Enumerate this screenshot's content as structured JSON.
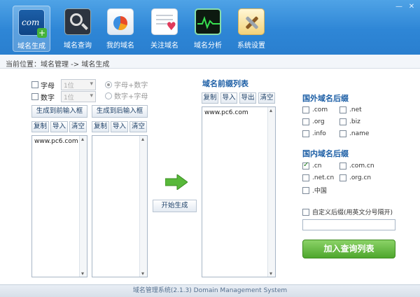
{
  "toolbar": {
    "items": [
      {
        "label": "域名生成",
        "icon": "com-plus-icon"
      },
      {
        "label": "域名查询",
        "icon": "magnifier-icon"
      },
      {
        "label": "我的域名",
        "icon": "pie-chart-icon"
      },
      {
        "label": "关注域名",
        "icon": "heart-list-icon"
      },
      {
        "label": "域名分析",
        "icon": "pulse-chart-icon"
      },
      {
        "label": "系统设置",
        "icon": "tools-icon"
      }
    ],
    "icon_text": "com",
    "icon_plus": "+"
  },
  "window": {
    "minimize": "—",
    "close": "✕"
  },
  "breadcrumb": "当前位置：域名管理 -> 域名生成",
  "generator": {
    "letters_label": "字母",
    "digits_label": "数字",
    "letters_len": "1位",
    "digits_len": "1位",
    "mode1": "字母+数字",
    "mode2": "数字+字母",
    "gen_to_prefix": "生成到前输入框",
    "gen_to_suffix": "生成到后输入框",
    "copy": "复制",
    "import": "导入",
    "clear": "清空",
    "prefix_input_text": "www.pc6.com",
    "start": "开始生成"
  },
  "prefix_list": {
    "title": "域名前缀列表",
    "copy": "复制",
    "import": "导入",
    "export": "导出",
    "clear": "清空",
    "text": "www.pc6.com"
  },
  "foreign": {
    "title": "国外域名后缀",
    "items": [
      {
        "label": ".com",
        "checked": false
      },
      {
        "label": ".net",
        "checked": false
      },
      {
        "label": ".org",
        "checked": false
      },
      {
        "label": ".biz",
        "checked": false
      },
      {
        "label": ".info",
        "checked": false
      },
      {
        "label": ".name",
        "checked": false
      }
    ]
  },
  "domestic": {
    "title": "国内域名后缀",
    "items": [
      {
        "label": ".cn",
        "checked": true
      },
      {
        "label": ".com.cn",
        "checked": false
      },
      {
        "label": ".net.cn",
        "checked": false
      },
      {
        "label": ".org.cn",
        "checked": false
      },
      {
        "label": ".中国",
        "checked": false
      }
    ]
  },
  "custom": {
    "label": "自定义后缀(用英文分号隔开)",
    "value": ""
  },
  "add_button": "加入查询列表",
  "status": "域名管理系统(2.1.3) Domain Management System",
  "colors": {
    "accent": "#2e86d6",
    "title_blue": "#1d5fa6",
    "green": "#4ea72d"
  }
}
